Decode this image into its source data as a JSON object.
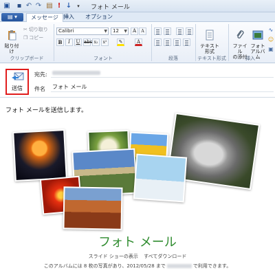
{
  "window": {
    "title": "フォト メール"
  },
  "tabs": [
    {
      "label": "メッセージ",
      "active": true
    },
    {
      "label": "挿入",
      "active": false
    },
    {
      "label": "オプション",
      "active": false
    }
  ],
  "ribbon": {
    "clipboard": {
      "paste": "貼り付け",
      "cut": "切り取り",
      "copy": "コピー",
      "label": "クリップボード"
    },
    "font": {
      "family": "Calibri",
      "size": "12",
      "label": "フォント"
    },
    "paragraph": {
      "label": "段落"
    },
    "text_format": {
      "plain_text": "テキスト\n形式",
      "label": "テキスト形式"
    },
    "insert": {
      "attach": "ファイル\nの添付",
      "album": "フォト\nアルバム",
      "label": "挿入"
    }
  },
  "compose": {
    "send_label": "送信",
    "to_label": "宛先:",
    "subject_label": "件名",
    "subject_value": "フォト メール"
  },
  "body": {
    "intro": "フォト メールを送信します。",
    "album_title": "フォト メール",
    "slideshow_link": "スライド ショーの表示",
    "download_link": "すべてダウンロード",
    "note_before": "このアルバムには 8 枚の写真があり、2012/05/28 まで",
    "note_after": "で利用できます。"
  },
  "colors": {
    "accent": "#2e8b2e",
    "highlight_border": "#e01b1b",
    "app_button": "#2f5fa8"
  }
}
